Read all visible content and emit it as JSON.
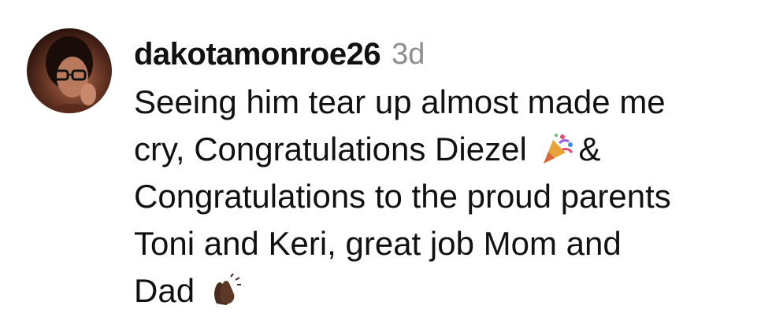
{
  "comment": {
    "username": "dakotamonroe26",
    "timestamp": "3d",
    "lines": [
      "Seeing him tear up almost made me",
      "cry, Congratulations Diezel",
      "& ",
      "Congratulations to the proud parents",
      "Toni and Keri, great job Mom and",
      "Dad"
    ],
    "avatar_icon": "avatar-woman-glasses-icon",
    "emojis": [
      "party-popper-icon",
      "clapping-hands-icon"
    ]
  }
}
